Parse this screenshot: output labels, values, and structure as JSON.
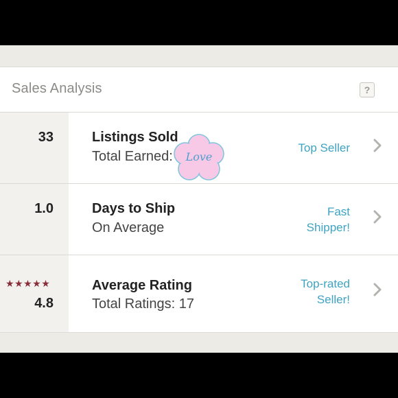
{
  "header": {
    "title": "Sales Analysis",
    "help_label": "?"
  },
  "rows": [
    {
      "stat": "33",
      "title": "Listings Sold",
      "subtitle": "Total Earned:",
      "badge": "Top Seller",
      "chevron": "chevron-right-icon"
    },
    {
      "stat": "1.0",
      "title": "Days to Ship",
      "subtitle": "On Average",
      "badge_line1": "Fast",
      "badge_line2": "Shipper!",
      "chevron": "chevron-right-icon"
    },
    {
      "stat": "4.8",
      "stars": "★★★★★",
      "rating": 4.8,
      "title": "Average Rating",
      "subtitle": "Total Ratings: 17",
      "badge_line1": "Top-rated",
      "badge_line2": "Seller!",
      "chevron": "chevron-right-icon"
    }
  ],
  "sticker": {
    "text": "Love",
    "icon": "flower-sticker-icon"
  },
  "colors": {
    "accent": "#3ea3c2",
    "star": "#8a2d3a",
    "sticker": "#f7c9e6"
  }
}
